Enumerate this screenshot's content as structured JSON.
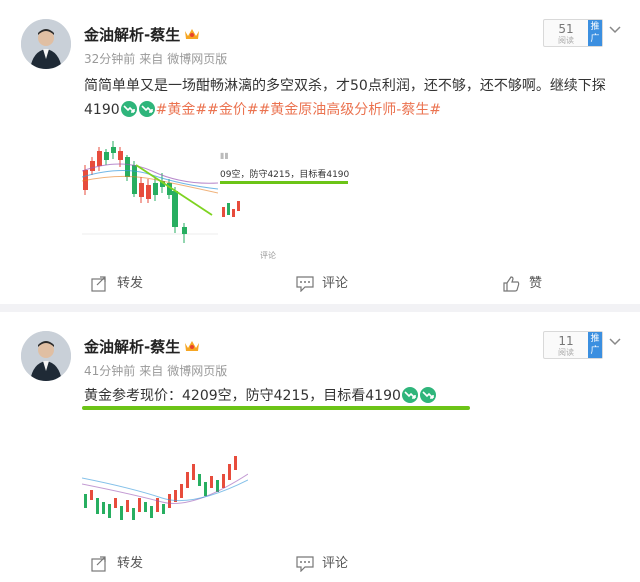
{
  "posts": [
    {
      "author": "金油解析-蔡生",
      "time": "32分钟前",
      "source_prefix": "来自",
      "source": "微博网页版",
      "read_count": "51",
      "read_label": "阅读",
      "promote_label": "推广",
      "text_main": "简简单单又是一场酣畅淋漓的多空双杀，才50点利润，还不够，还不够啊。继续下探4190",
      "tags": [
        "#黄金#",
        "#金价#",
        "#黄金原油高级分析师-蔡生#"
      ],
      "image_text": "09空，防守4215，目标看4190",
      "image_comment": "评论",
      "actions": {
        "repost": "转发",
        "comment": "评论",
        "like": "赞"
      }
    },
    {
      "author": "金油解析-蔡生",
      "time": "41分钟前",
      "source_prefix": "来自",
      "source": "微博网页版",
      "read_count": "11",
      "read_label": "阅读",
      "promote_label": "推广",
      "text_main": "黄金参考现价：4209空，防守4215，目标看4190",
      "actions": {
        "repost": "转发",
        "comment": "评论"
      }
    }
  ],
  "colors": {
    "tag": "#eb7350",
    "underline": "#6cc417",
    "emoji": "#2fb57b",
    "promote": "#3b8fe0",
    "candle_up": "#e74c3c",
    "candle_down": "#27ae60"
  },
  "icons": [
    "crown-icon",
    "chevron-down-icon",
    "repost-icon",
    "comment-icon",
    "like-icon",
    "down-trend-emoji-icon"
  ]
}
